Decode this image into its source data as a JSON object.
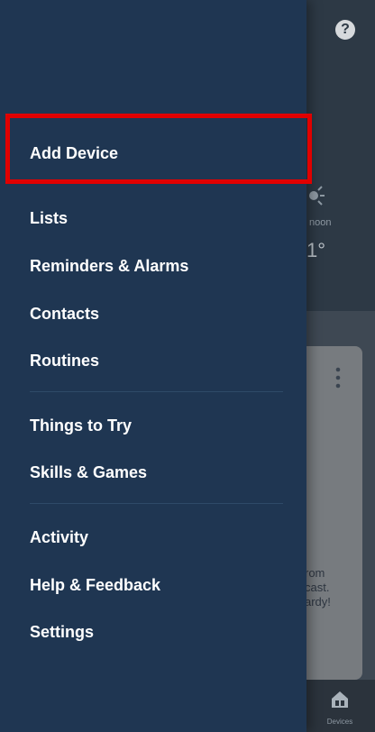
{
  "background": {
    "help_glyph": "?",
    "weather_label": "noon",
    "weather_temp": "1°",
    "card_text_lines": [
      "rom",
      "cast.",
      "ardy!"
    ],
    "card_menu_glyph": "⋮",
    "bottom_nav": {
      "devices_label": "Devices"
    }
  },
  "drawer": {
    "menu_groups": [
      {
        "items": [
          {
            "label": "Add Device"
          }
        ]
      },
      {
        "items": [
          {
            "label": "Lists"
          },
          {
            "label": "Reminders & Alarms"
          },
          {
            "label": "Contacts"
          },
          {
            "label": "Routines"
          }
        ]
      },
      {
        "items": [
          {
            "label": "Things to Try"
          },
          {
            "label": "Skills & Games"
          }
        ]
      },
      {
        "items": [
          {
            "label": "Activity"
          },
          {
            "label": "Help & Feedback"
          },
          {
            "label": "Settings"
          }
        ]
      }
    ]
  },
  "colors": {
    "drawer_bg": "#1f3652",
    "highlight": "#e00000",
    "text": "#ffffff"
  },
  "icons": [
    "help-icon",
    "sun-icon",
    "more-vert-icon",
    "devices-icon"
  ]
}
